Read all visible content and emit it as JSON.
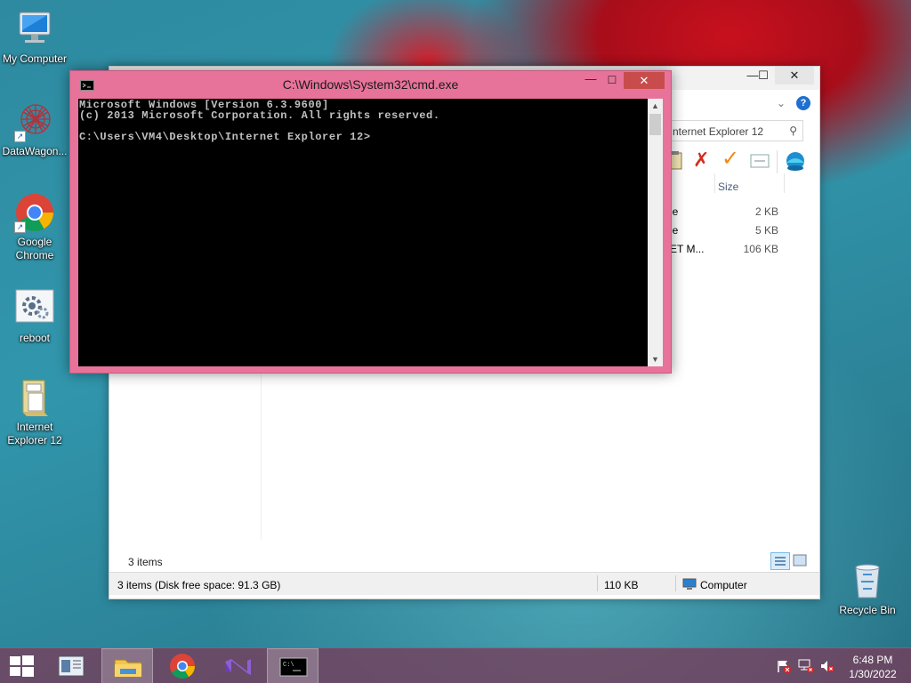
{
  "desktop": {
    "icons": [
      {
        "label": "My Computer"
      },
      {
        "label": "DataWagon..."
      },
      {
        "label": "Google Chrome"
      },
      {
        "label": "reboot"
      },
      {
        "label": "Internet Explorer 12"
      },
      {
        "label": "Recycle Bin"
      }
    ]
  },
  "cmd": {
    "title": "C:\\Windows\\System32\\cmd.exe",
    "lines": [
      "Microsoft Windows [Version 6.3.9600]",
      "(c) 2013 Microsoft Corporation. All rights reserved.",
      "",
      "C:\\Users\\VM4\\Desktop\\Internet Explorer 12>"
    ]
  },
  "explorer": {
    "search_placeholder": "nternet Explorer 12",
    "column_size": "Size",
    "rows": [
      {
        "type_fragment": "le",
        "size": "2 KB"
      },
      {
        "type_fragment": "le",
        "size": "5 KB"
      },
      {
        "type_fragment": "ET M...",
        "size": "106 KB"
      }
    ],
    "item_count": "3 items",
    "status_left": "3 items (Disk free space: 91.3 GB)",
    "status_size": "110 KB",
    "status_location": "Computer"
  },
  "taskbar": {
    "time": "6:48 PM",
    "date": "1/30/2022"
  },
  "colors": {
    "cmd_frame": "#e8739a",
    "taskbar": "#7a3c5a"
  }
}
